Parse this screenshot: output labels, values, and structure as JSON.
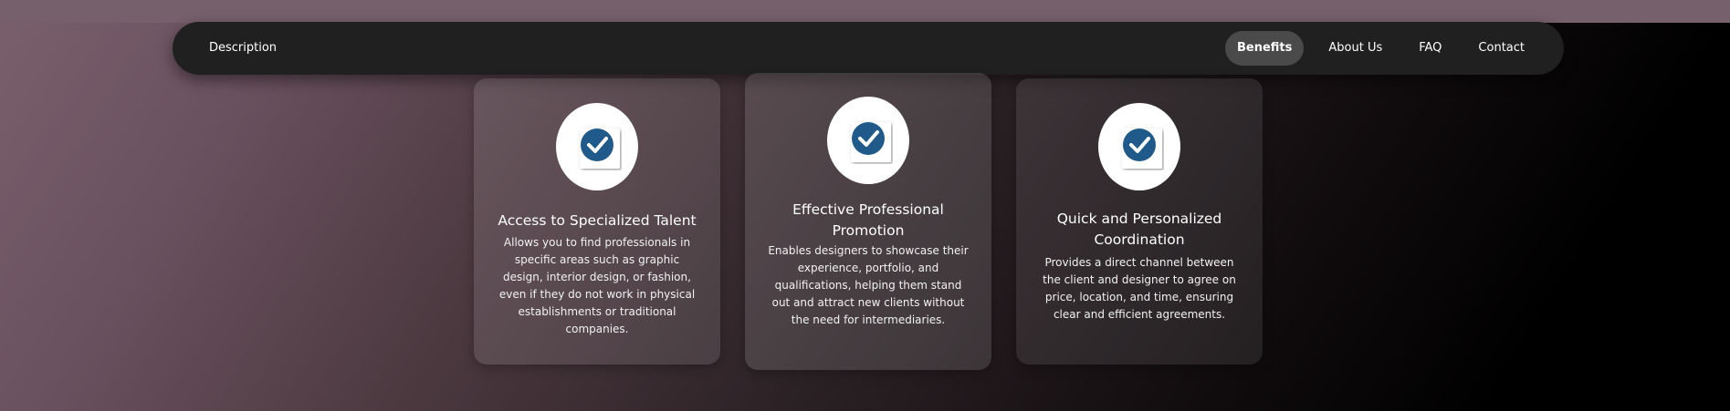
{
  "colors": {
    "navbar_bg": "#202020",
    "active_pill_bg": "#4a4a4a",
    "check_icon_blue": "#1f5a8a",
    "text": "#ffffff"
  },
  "navbar": {
    "brand": "Description",
    "links": [
      {
        "label": "Benefits",
        "active": true
      },
      {
        "label": "About Us",
        "active": false
      },
      {
        "label": "FAQ",
        "active": false
      },
      {
        "label": "Contact",
        "active": false
      }
    ]
  },
  "cards": [
    {
      "icon": "check-circle-icon",
      "title": "Access to Specialized Talent",
      "description": "Allows you to find professionals in specific areas such as graphic design, interior design, or fashion, even if they do not work in physical establishments or traditional companies."
    },
    {
      "icon": "check-circle-icon",
      "title": "Effective Professional Promotion",
      "description": "Enables designers to showcase their experience, portfolio, and qualifications, helping them stand out and attract new clients without the need for intermediaries."
    },
    {
      "icon": "check-circle-icon",
      "title": "Quick and Personalized Coordination",
      "description": "Provides a direct channel between the client and designer to agree on price, location, and time, ensuring clear and efficient agreements."
    }
  ]
}
